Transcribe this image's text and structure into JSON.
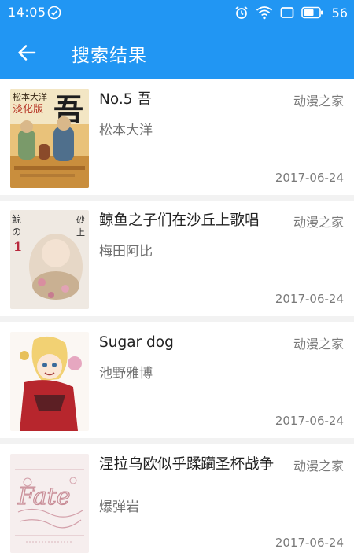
{
  "status_bar": {
    "time": "14:05",
    "battery": "56",
    "icons": [
      "check-circle-icon",
      "alarm-icon",
      "wifi-icon",
      "screen-icon",
      "battery-icon"
    ]
  },
  "app_bar": {
    "title": "搜索结果",
    "back_icon": "arrow-left-icon",
    "background": "#2196f3"
  },
  "results": [
    {
      "title": "No.5 吾",
      "author": "松本大洋",
      "source": "动漫之家",
      "date": "2017-06-24"
    },
    {
      "title": "鲸鱼之子们在沙丘上歌唱",
      "author": "梅田阿比",
      "source": "动漫之家",
      "date": "2017-06-24"
    },
    {
      "title": "Sugar dog",
      "author": "池野雅博",
      "source": "动漫之家",
      "date": "2017-06-24"
    },
    {
      "title": "涅拉乌欧似乎蹂躏圣杯战争",
      "author": "爆弹岩",
      "source": "动漫之家",
      "date": "2017-06-24"
    }
  ]
}
